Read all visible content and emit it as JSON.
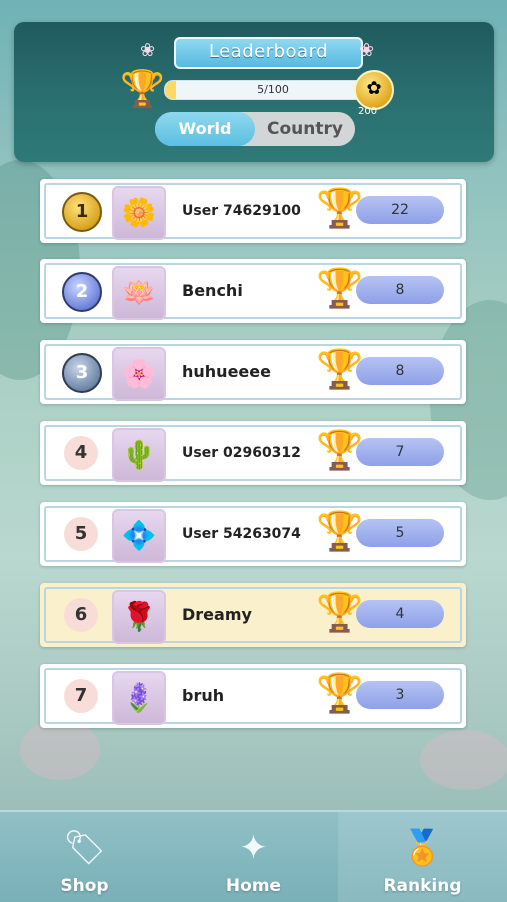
{
  "header": {
    "title": "Leaderboard",
    "progress_text": "5/100",
    "progress_fraction": 0.05,
    "coin_value": "200",
    "tabs": {
      "world": "World",
      "country": "Country"
    },
    "active_tab": "World"
  },
  "rows": [
    {
      "rank": "1",
      "name": "User 74629100",
      "score": "22",
      "avatar": "white-flower-icon"
    },
    {
      "rank": "2",
      "name": "Benchi",
      "score": "8",
      "avatar": "blue-lotus-icon"
    },
    {
      "rank": "3",
      "name": "huhueeee",
      "score": "8",
      "avatar": "pink-flower-icon"
    },
    {
      "rank": "4",
      "name": "User 02960312",
      "score": "7",
      "avatar": "orange-flower-icon"
    },
    {
      "rank": "5",
      "name": "User 54263074",
      "score": "5",
      "avatar": "blue-flower-icon"
    },
    {
      "rank": "6",
      "name": "Dreamy",
      "score": "4",
      "avatar": "pink-rose-icon"
    },
    {
      "rank": "7",
      "name": "bruh",
      "score": "3",
      "avatar": "purple-flower-icon"
    }
  ],
  "nav": {
    "shop": "Shop",
    "home": "Home",
    "ranking": "Ranking",
    "active": "Ranking"
  },
  "colors": {
    "header_bg": "#2a6e6f",
    "accent_blue": "#5bbfe2",
    "score_pill": "#8ea0e8",
    "highlight_row": "#fbf0cc"
  }
}
